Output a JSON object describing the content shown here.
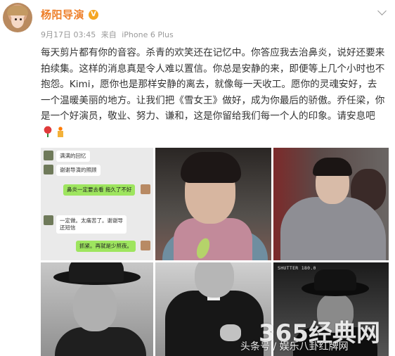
{
  "post": {
    "author": "杨阳导演",
    "verified_badge": "V",
    "timestamp": "9月17日 03:45",
    "source_prefix": "来自",
    "source": "iPhone 6 Plus",
    "text": "每天剪片都有你的音容。杀青的欢笑还在记忆中。你答应我去治鼻炎，说好还要来拍续集。这样的消息真是令人难以置信。你总是安静的来，即便等上几个小时也不抱怨。Kimi，愿你也是那样安静的离去，就像每一天收工。愿你的灵魂安好，去一个温暖美丽的地方。让我们把《雪女王》做好，成为你最后的骄傲。乔任梁，你是一个好演员，敬业、努力、谦和，这是你留给我们每一个人的印象。请安息吧",
    "emojis": [
      "rose-icon",
      "candle-icon"
    ]
  },
  "chat": {
    "messages": [
      {
        "dir": "in",
        "text": "满满的回忆"
      },
      {
        "dir": "in",
        "text": "谢谢导演的照顾"
      },
      {
        "dir": "out",
        "text": "鼻炎一定要去看 拖久了不好"
      },
      {
        "dir": "in",
        "text": "一定做。太痛苦了。谢谢导"
      },
      {
        "dir": "in",
        "text": "还短信"
      },
      {
        "dir": "out",
        "text": "抓紧。再就是少熬夜。"
      }
    ]
  },
  "photo_hud": "SHUTTER 180.0",
  "watermark": {
    "main": "365经典网",
    "sub": "头条号 / 娱乐八卦红牌网"
  },
  "colors": {
    "author": "#ee7f2a",
    "meta": "#999999",
    "chat_out": "#9ee55f"
  }
}
